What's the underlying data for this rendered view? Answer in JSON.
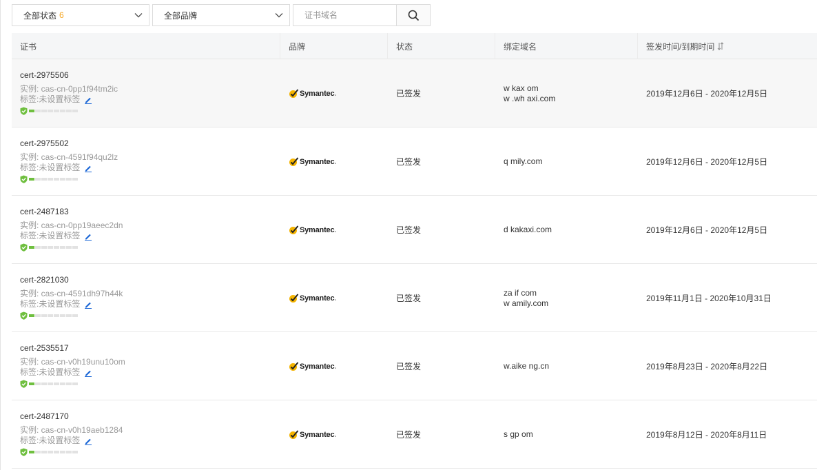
{
  "filters": {
    "status_label": "全部状态",
    "status_count": "6",
    "brand_label": "全部品牌",
    "search_placeholder": "证书域名"
  },
  "table": {
    "headers": [
      "证书",
      "品牌",
      "状态",
      "绑定域名",
      "签发时间/到期时间"
    ],
    "rows": [
      {
        "name": "cert-2975506",
        "instance": "实例: cas-cn-0pp1f94tm2ic",
        "tag": "标签:未设置标签",
        "brand": "Symantec",
        "status": "已签发",
        "domains": [
          "w kax om",
          "w .wh axi.com"
        ],
        "dates": "2019年12月6日 - 2020年12月5日"
      },
      {
        "name": "cert-2975502",
        "instance": "实例: cas-cn-4591f94qu2lz",
        "tag": "标签:未设置标签",
        "brand": "Symantec",
        "status": "已签发",
        "domains": [
          "q mily.com"
        ],
        "dates": "2019年12月6日 - 2020年12月5日"
      },
      {
        "name": "cert-2487183",
        "instance": "实例: cas-cn-0pp19aeec2dn",
        "tag": "标签:未设置标签",
        "brand": "Symantec",
        "status": "已签发",
        "domains": [
          "d kakaxi.com"
        ],
        "dates": "2019年12月6日 - 2020年12月5日"
      },
      {
        "name": "cert-2821030",
        "instance": "实例: cas-cn-4591dh97h44k",
        "tag": "标签:未设置标签",
        "brand": "Symantec",
        "status": "已签发",
        "domains": [
          "za if com",
          "w amily.com"
        ],
        "dates": "2019年11月1日 - 2020年10月31日"
      },
      {
        "name": "cert-2535517",
        "instance": "实例: cas-cn-v0h19unu10om",
        "tag": "标签:未设置标签",
        "brand": "Symantec",
        "status": "已签发",
        "domains": [
          "",
          "w.aike ng.cn"
        ],
        "dates": "2019年8月23日 - 2020年8月22日"
      },
      {
        "name": "cert-2487170",
        "instance": "实例: cas-cn-v0h19aeb1284",
        "tag": "标签:未设置标签",
        "brand": "Symantec",
        "status": "已签发",
        "domains": [
          "s gp om"
        ],
        "dates": "2019年8月12日 - 2020年8月11日"
      }
    ]
  },
  "icons": {
    "dropdown": "chevron-down-icon",
    "search": "search-icon",
    "sort": "sort-icon",
    "edit": "edit-icon",
    "shield": "shield-check-icon",
    "brand": "symantec-check-icon"
  },
  "colors": {
    "accent": "#f5a623",
    "edit_icon": "#1a66d6",
    "level_on": "#6fbf3f",
    "level_off": "#e2e2e2",
    "brand_check": "#f5b400"
  }
}
